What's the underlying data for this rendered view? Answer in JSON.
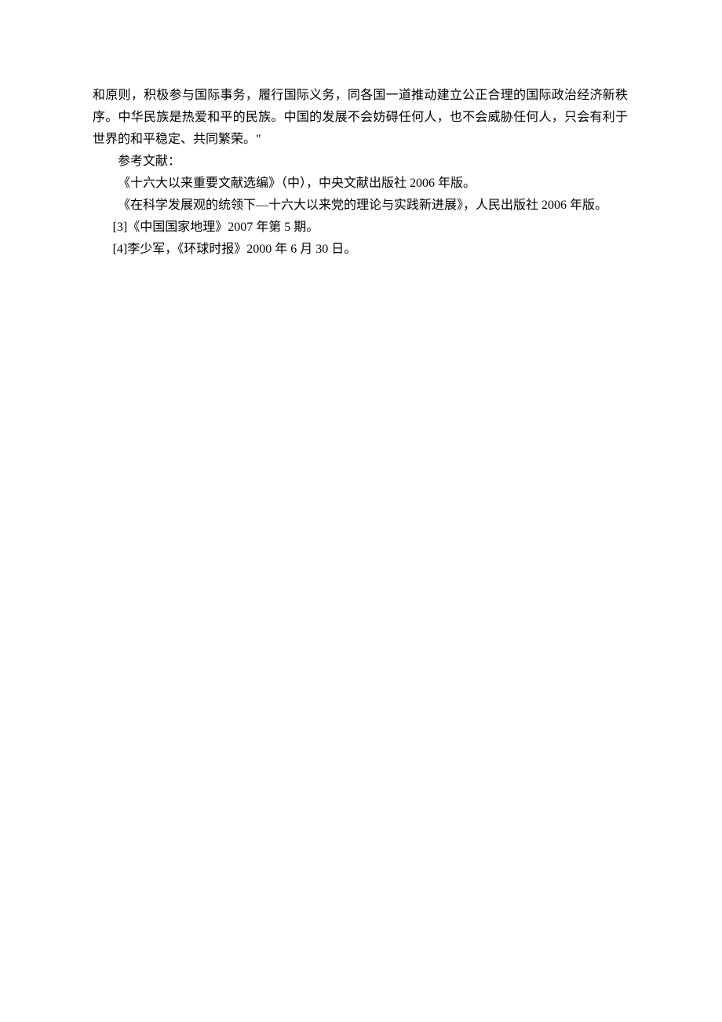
{
  "paragraph": "和原则，积极参与国际事务，履行国际义务，同各国一道推动建立公正合理的国际政治经济新秩序。中华民族是热爱和平的民族。中国的发展不会妨碍任何人，也不会威胁任何人，只会有利于世界的和平稳定、共同繁荣。\"",
  "ref_heading": "参考文献：",
  "references": [
    "《十六大以来重要文献选编》（中），中央文献出版社 2006 年版。",
    "《在科学发展观的统领下—十六大以来党的理论与实践新进展》，人民出版社 2006 年版。",
    "[3]《中国国家地理》2007 年第 5 期。",
    "[4]李少军，《环球时报》2000 年 6 月 30 日。"
  ]
}
